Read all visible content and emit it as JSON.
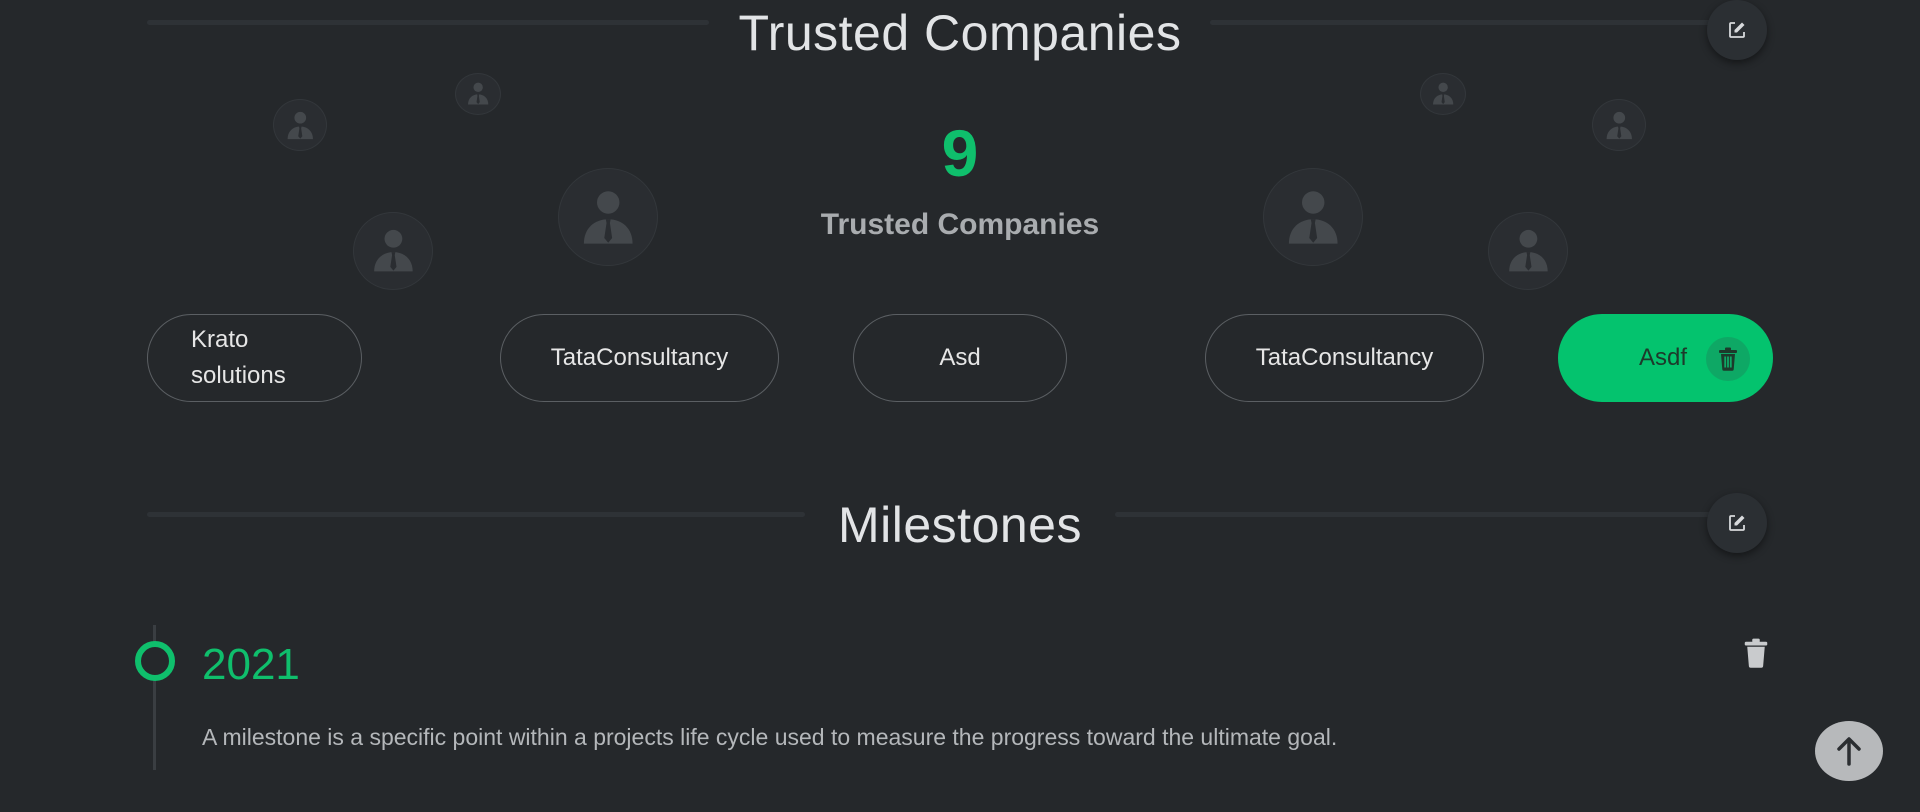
{
  "trusted_companies": {
    "section_title": "Trusted Companies",
    "count": "9",
    "count_label": "Trusted Companies",
    "companies": [
      {
        "name_line1": "Krato",
        "name_line2": "solutions"
      },
      {
        "name": "TataConsultancy"
      },
      {
        "name": "Asd"
      },
      {
        "name": "TataConsultancy"
      },
      {
        "name": "Asdf"
      }
    ],
    "edit_icon": "edit-icon",
    "avatar_icon": "person-with-tie-icon",
    "delete_icon": "trash-icon"
  },
  "milestones": {
    "section_title": "Milestones",
    "items": [
      {
        "year": "2021",
        "description": "A milestone is a specific point within a projects life cycle used to measure the progress toward the ultimate goal."
      }
    ],
    "edit_icon": "edit-icon",
    "delete_icon": "trash-icon"
  },
  "scroll_top_icon": "arrow-up-icon",
  "colors": {
    "background": "#25282b",
    "accent": "#04c36e",
    "text": "#e6e6e6"
  }
}
